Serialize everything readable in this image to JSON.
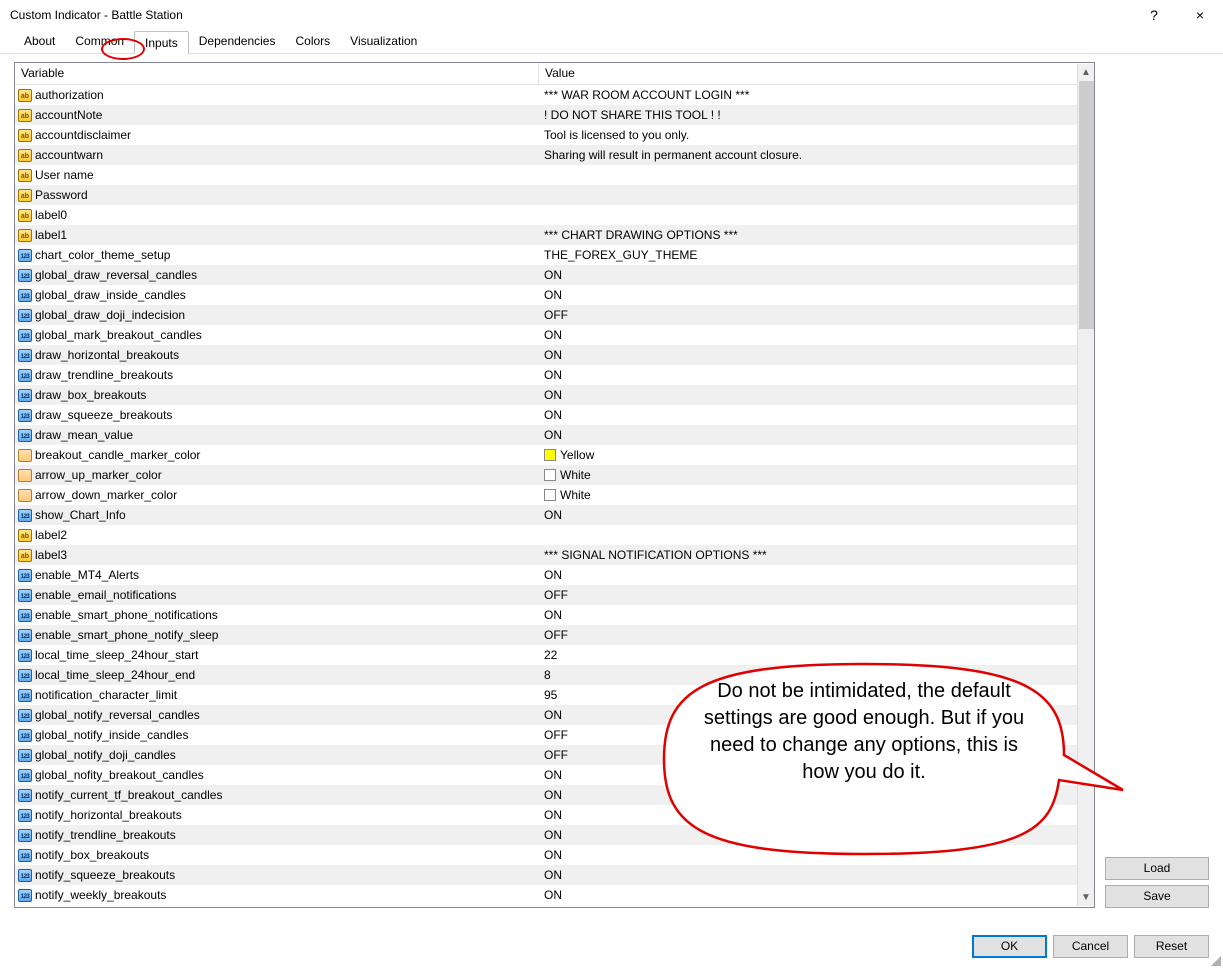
{
  "window": {
    "title": "Custom Indicator - Battle Station",
    "help": "?",
    "close": "×"
  },
  "tabs": [
    "About",
    "Common",
    "Inputs",
    "Dependencies",
    "Colors",
    "Visualization"
  ],
  "active_tab_index": 2,
  "headers": {
    "variable": "Variable",
    "value": "Value"
  },
  "rows": [
    {
      "icon": "ab",
      "name": "authorization",
      "value": "*** WAR ROOM ACCOUNT LOGIN ***"
    },
    {
      "icon": "ab",
      "name": "accountNote",
      "value": " ! DO NOT SHARE THIS TOOL ! !"
    },
    {
      "icon": "ab",
      "name": "accountdisclaimer",
      "value": "Tool is licensed to you only."
    },
    {
      "icon": "ab",
      "name": "accountwarn",
      "value": "Sharing will result in permanent account closure."
    },
    {
      "icon": "ab",
      "name": "User name",
      "value": ""
    },
    {
      "icon": "ab",
      "name": "Password",
      "value": ""
    },
    {
      "icon": "ab",
      "name": "label0",
      "value": ""
    },
    {
      "icon": "ab",
      "name": "label1",
      "value": "*** CHART DRAWING OPTIONS ***"
    },
    {
      "icon": "123",
      "name": "chart_color_theme_setup",
      "value": "THE_FOREX_GUY_THEME"
    },
    {
      "icon": "123",
      "name": "global_draw_reversal_candles",
      "value": "ON"
    },
    {
      "icon": "123",
      "name": "global_draw_inside_candles",
      "value": "ON"
    },
    {
      "icon": "123",
      "name": "global_draw_doji_indecision",
      "value": "OFF"
    },
    {
      "icon": "123",
      "name": "global_mark_breakout_candles",
      "value": "ON"
    },
    {
      "icon": "123",
      "name": "draw_horizontal_breakouts",
      "value": "ON"
    },
    {
      "icon": "123",
      "name": "draw_trendline_breakouts",
      "value": "ON"
    },
    {
      "icon": "123",
      "name": "draw_box_breakouts",
      "value": "ON"
    },
    {
      "icon": "123",
      "name": "draw_squeeze_breakouts",
      "value": "ON"
    },
    {
      "icon": "123",
      "name": "draw_mean_value",
      "value": "ON"
    },
    {
      "icon": "color",
      "name": "breakout_candle_marker_color",
      "value": "Yellow",
      "swatch": "yellow"
    },
    {
      "icon": "color",
      "name": "arrow_up_marker_color",
      "value": "White",
      "swatch": "white"
    },
    {
      "icon": "color",
      "name": "arrow_down_marker_color",
      "value": "White",
      "swatch": "white"
    },
    {
      "icon": "123",
      "name": "show_Chart_Info",
      "value": "ON"
    },
    {
      "icon": "ab",
      "name": "label2",
      "value": ""
    },
    {
      "icon": "ab",
      "name": "label3",
      "value": "*** SIGNAL NOTIFICATION OPTIONS ***"
    },
    {
      "icon": "123",
      "name": "enable_MT4_Alerts",
      "value": "ON"
    },
    {
      "icon": "123",
      "name": "enable_email_notifications",
      "value": "OFF"
    },
    {
      "icon": "123",
      "name": "enable_smart_phone_notifications",
      "value": "ON"
    },
    {
      "icon": "123",
      "name": "enable_smart_phone_notify_sleep",
      "value": "OFF"
    },
    {
      "icon": "123",
      "name": "local_time_sleep_24hour_start",
      "value": "22"
    },
    {
      "icon": "123",
      "name": "local_time_sleep_24hour_end",
      "value": "8"
    },
    {
      "icon": "123",
      "name": "notification_character_limit",
      "value": "95"
    },
    {
      "icon": "123",
      "name": "global_notify_reversal_candles",
      "value": "ON"
    },
    {
      "icon": "123",
      "name": "global_notify_inside_candles",
      "value": "OFF"
    },
    {
      "icon": "123",
      "name": "global_notify_doji_candles",
      "value": "OFF"
    },
    {
      "icon": "123",
      "name": "global_nofity_breakout_candles",
      "value": "ON"
    },
    {
      "icon": "123",
      "name": "notify_current_tf_breakout_candles",
      "value": "ON"
    },
    {
      "icon": "123",
      "name": "notify_horizontal_breakouts",
      "value": "ON"
    },
    {
      "icon": "123",
      "name": "notify_trendline_breakouts",
      "value": "ON"
    },
    {
      "icon": "123",
      "name": "notify_box_breakouts",
      "value": "ON"
    },
    {
      "icon": "123",
      "name": "notify_squeeze_breakouts",
      "value": "ON"
    },
    {
      "icon": "123",
      "name": "notify_weekly_breakouts",
      "value": "ON"
    }
  ],
  "side_buttons": {
    "load": "Load",
    "save": "Save"
  },
  "footer": {
    "ok": "OK",
    "cancel": "Cancel",
    "reset": "Reset"
  },
  "callout": "Do not be intimidated, the default settings are good enough. But if you need to change any options, this is how you do it."
}
